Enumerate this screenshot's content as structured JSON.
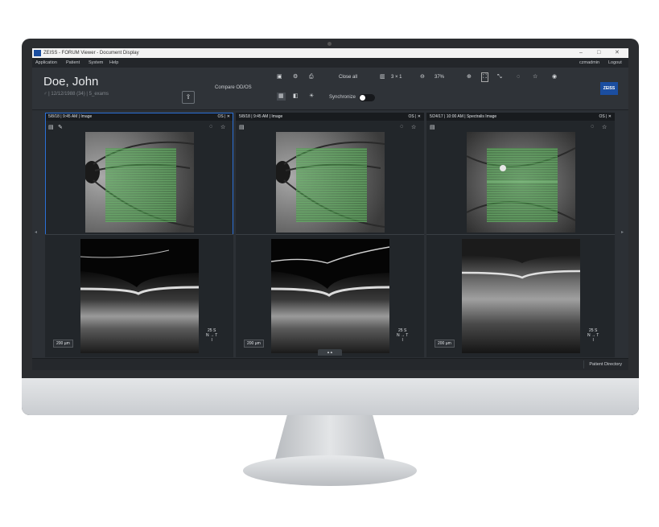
{
  "window": {
    "title": "ZEISS - FORUM Viewer - Document Display",
    "minimize": "–",
    "maximize": "□",
    "close": "✕"
  },
  "menu": {
    "items": [
      "Application",
      "Patient",
      "System",
      "Help"
    ],
    "user": "czmadmin",
    "logout": "Logout"
  },
  "patient": {
    "name": "Doe, John",
    "info": "♂ | 12/12/1988 (34) | 5_exams"
  },
  "toolbar": {
    "compare": "Compare OD/OS",
    "close_all": "Close all",
    "layout": "3 × 1",
    "zoom": "37%",
    "synchronize": "Synchronize",
    "brand": "ZEISS"
  },
  "panels": [
    {
      "header": "5/8/18 | 9:45 AM | Image",
      "eye": "OS",
      "scale": "200 µm",
      "orient_top": "25 S",
      "orient_mid": "N → T",
      "orient_bot": "I"
    },
    {
      "header": "5/8/18 | 9:45 AM | Image",
      "eye": "OS",
      "scale": "200 µm",
      "orient_top": "25 S",
      "orient_mid": "N → T",
      "orient_bot": "I"
    },
    {
      "header": "5/24/17 | 10:00 AM | Spectralis Image",
      "eye": "OS",
      "scale": "200 µm",
      "orient_top": "25 S",
      "orient_mid": "N → T",
      "orient_bot": "I"
    }
  ],
  "footer": {
    "patient_directory": "Patient Directory"
  },
  "colors": {
    "selection": "#2a6fd6",
    "brand": "#1b4ea0",
    "scan_overlay": "#4a9e4a"
  }
}
